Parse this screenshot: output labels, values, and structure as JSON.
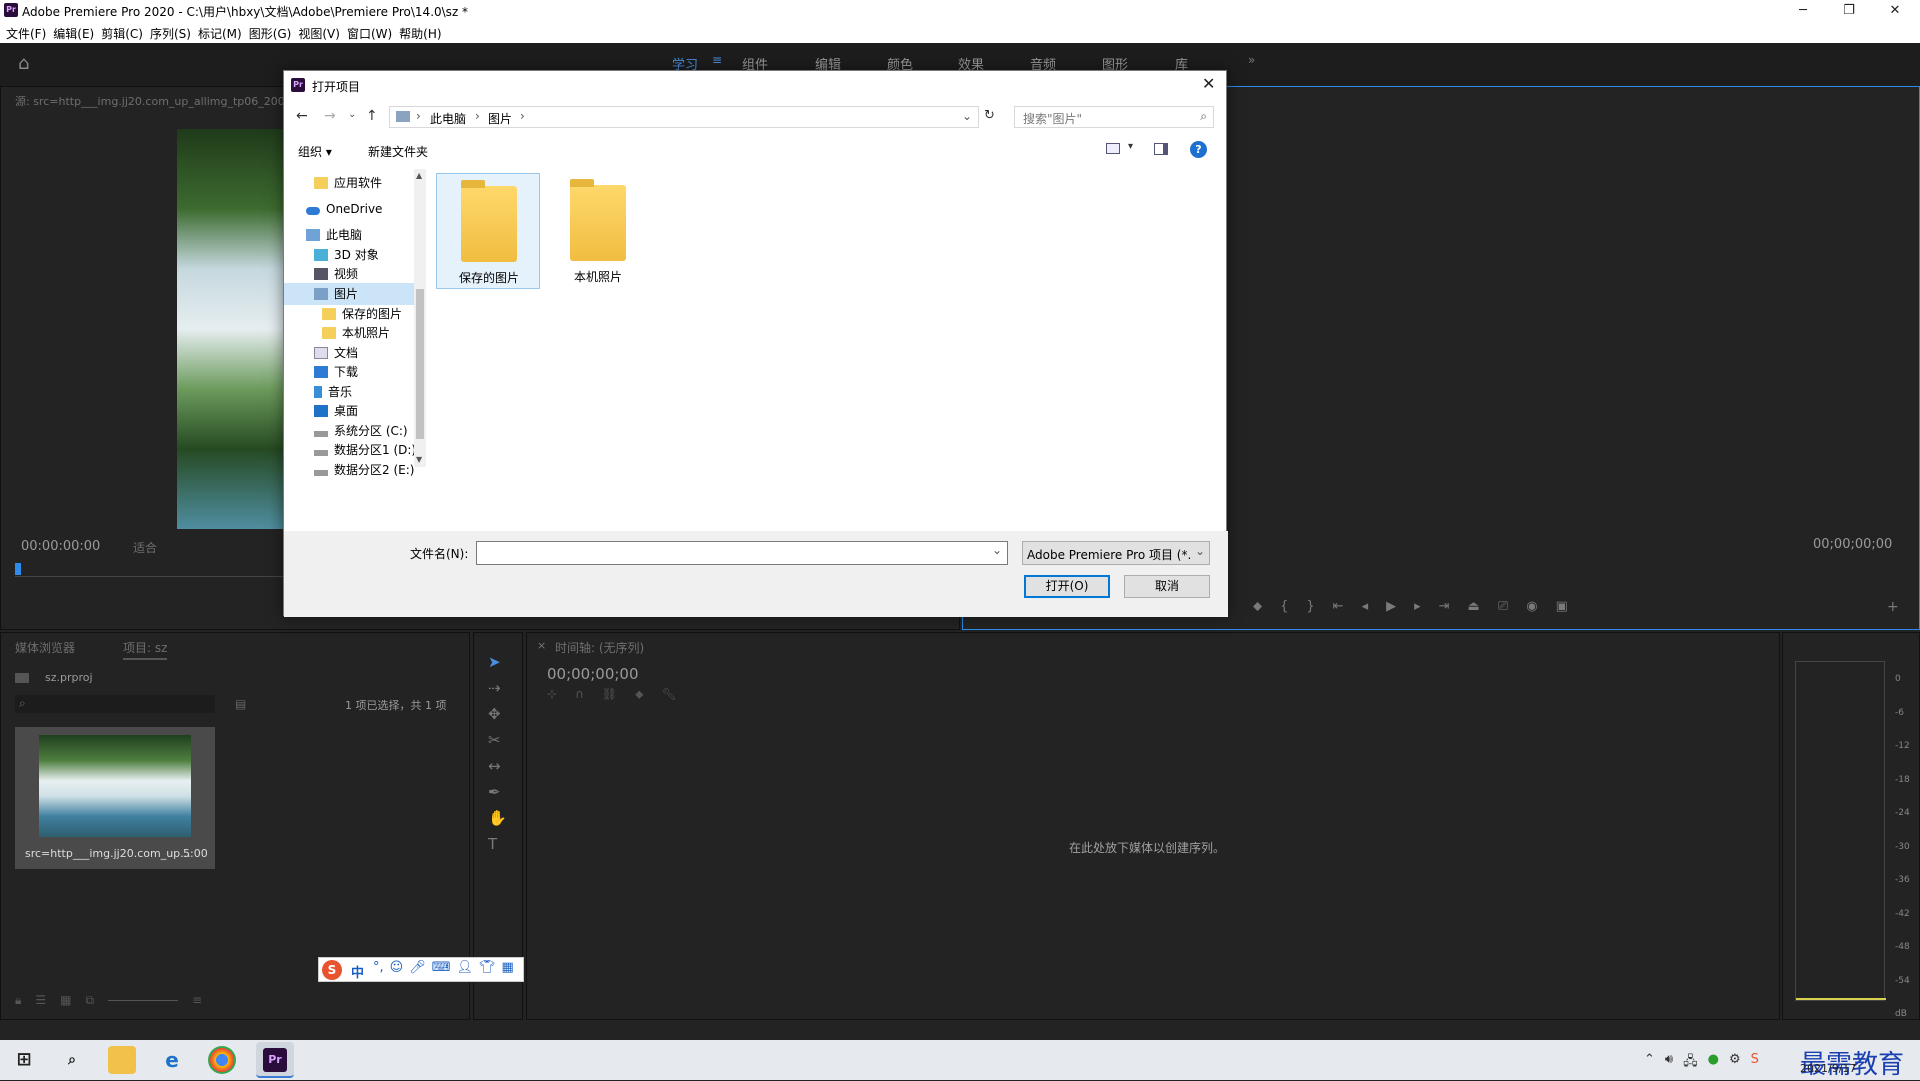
{
  "window": {
    "title": "Adobe Premiere Pro 2020 - C:\\用户\\hbxy\\文档\\Adobe\\Premiere Pro\\14.0\\sz *",
    "app_icon": "Pr"
  },
  "menu": [
    "文件(F)",
    "编辑(E)",
    "剪辑(C)",
    "序列(S)",
    "标记(M)",
    "图形(G)",
    "视图(V)",
    "窗口(W)",
    "帮助(H)"
  ],
  "workspaces": {
    "items": [
      "学习",
      "组件",
      "编辑",
      "颜色",
      "效果",
      "音频",
      "图形",
      "库"
    ],
    "active": "学习"
  },
  "source_panel": {
    "title": "源: src=http___img.jj20.com_up_allimg_tp06_200225",
    "timecode": "00:00:00:00",
    "fit_label": "适合"
  },
  "program_panel": {
    "timecode": "00;00;00;00"
  },
  "project_panel": {
    "tabs": [
      "媒体浏览器",
      "项目: sz"
    ],
    "project_file": "sz.prproj",
    "selection_info": "1 项已选择，共 1 项",
    "clip_name": "src=http___img.jj20.com_up...",
    "clip_duration": "5:00"
  },
  "timeline": {
    "tab_label": "时间轴: (无序列)",
    "timecode": "00;00;00;00",
    "drop_hint": "在此处放下媒体以创建序列。"
  },
  "meter": {
    "labels": [
      "0",
      "-6",
      "-12",
      "-18",
      "-24",
      "-30",
      "-36",
      "-42",
      "-48",
      "-54",
      "dB"
    ]
  },
  "dialog": {
    "title": "打开项目",
    "breadcrumb": [
      "此电脑",
      "图片"
    ],
    "search_placeholder": "搜索\"图片\"",
    "organize_label": "组织 ▾",
    "new_folder_label": "新建文件夹",
    "nav_items": [
      {
        "label": "应用软件",
        "icon": "folder-icon"
      },
      {
        "label": "OneDrive",
        "icon": "cloud-icon"
      },
      {
        "label": "此电脑",
        "icon": "computer-icon"
      },
      {
        "label": "3D 对象",
        "icon": "cube-icon"
      },
      {
        "label": "视频",
        "icon": "video-icon"
      },
      {
        "label": "图片",
        "icon": "pictures-icon"
      },
      {
        "label": "保存的图片",
        "icon": "folder-icon"
      },
      {
        "label": "本机照片",
        "icon": "folder-icon"
      },
      {
        "label": "文档",
        "icon": "document-icon"
      },
      {
        "label": "下载",
        "icon": "download-icon"
      },
      {
        "label": "音乐",
        "icon": "music-icon"
      },
      {
        "label": "桌面",
        "icon": "desktop-icon"
      },
      {
        "label": "系统分区 (C:)",
        "icon": "drive-icon"
      },
      {
        "label": "数据分区1 (D:)",
        "icon": "drive-icon"
      },
      {
        "label": "数据分区2 (E:)",
        "icon": "drive-icon"
      }
    ],
    "folders": [
      "保存的图片",
      "本机照片"
    ],
    "filename_label": "文件名(N):",
    "filename_value": "",
    "filetype": "Adobe Premiere Pro 项目 (*.",
    "open_label": "打开(O)",
    "cancel_label": "取消"
  },
  "ime": {
    "mode": "中"
  },
  "taskbar": {
    "date": "2021/9/17",
    "watermark": "最需教育"
  }
}
